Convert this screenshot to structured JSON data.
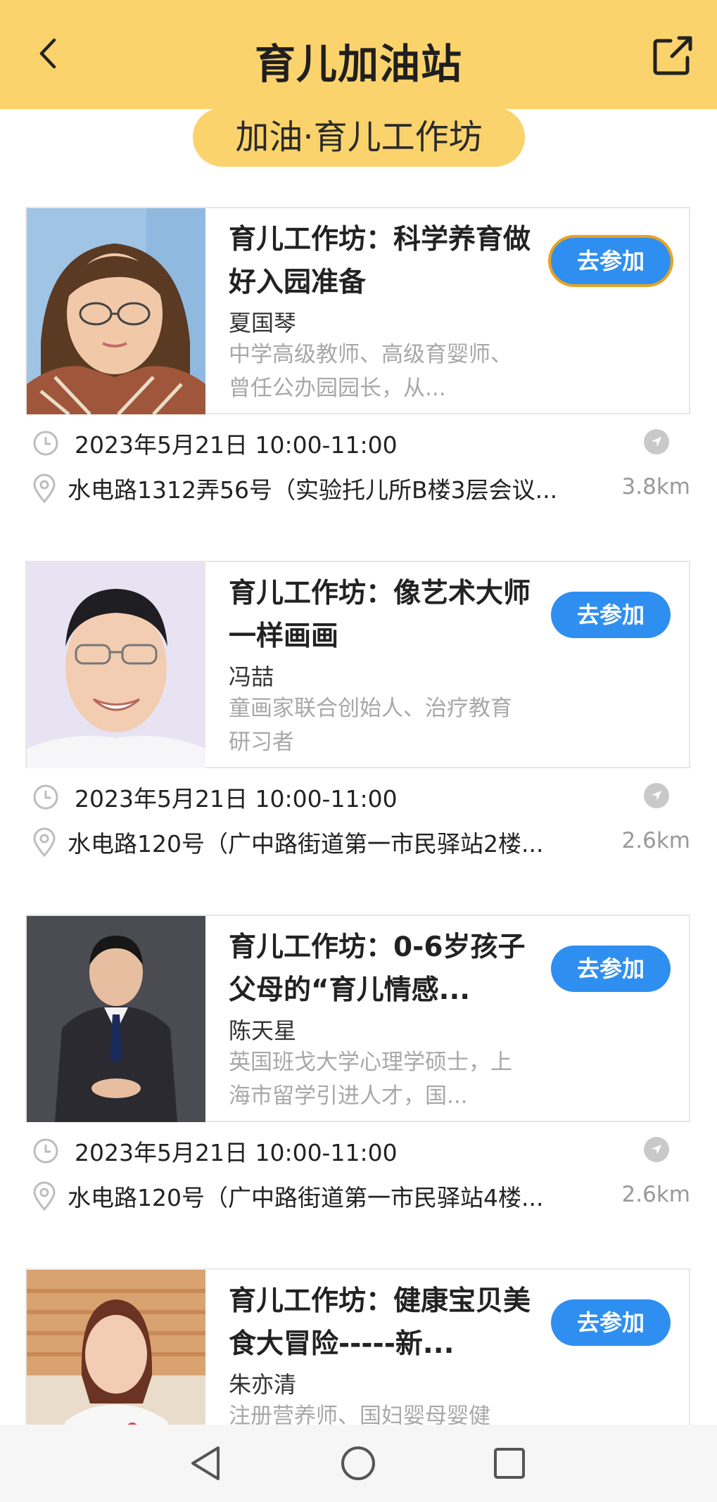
{
  "header": {
    "title": "育儿加油站"
  },
  "section": {
    "title": "加油·育儿工作坊"
  },
  "items": [
    {
      "title": "育儿工作坊：科学养育做好入园准备",
      "speaker": "夏国琴",
      "description": "中学高级教师、高级育婴师、曾任公办园园长，从...",
      "button": "去参加",
      "time": "2023年5月21日 10:00-11:00",
      "location": "水电路1312弄56号（实验托儿所B楼3层会议...",
      "distance": "3.8km"
    },
    {
      "title": "育儿工作坊：像艺术大师一样画画",
      "speaker": "冯喆",
      "description": "童画家联合创始人、治疗教育研习者",
      "button": "去参加",
      "time": "2023年5月21日 10:00-11:00",
      "location": "水电路120号（广中路街道第一市民驿站2楼...",
      "distance": "2.6km"
    },
    {
      "title": "育儿工作坊：0-6岁孩子父母的“育儿情感...",
      "speaker": "陈天星",
      "description": "英国班戈大学心理学硕士，上海市留学引进人才，国...",
      "button": "去参加",
      "time": "2023年5月21日 10:00-11:00",
      "location": "水电路120号（广中路街道第一市民驿站4楼...",
      "distance": "2.6km"
    },
    {
      "title": "育儿工作坊：健康宝贝美食大冒险-----新...",
      "speaker": "朱亦清",
      "description": "注册营养师、国妇婴母婴健",
      "button": "去参加"
    }
  ],
  "colors": {
    "header": "#fbd36c",
    "button": "#2f8ff0",
    "focus": "#e8a322"
  },
  "icons": {
    "back": "chevron-left-icon",
    "share": "share-icon",
    "clock": "clock-icon",
    "pin": "location-pin-icon",
    "nav": "navigation-arrow-icon",
    "sys_back": "triangle-back-icon",
    "sys_home": "circle-home-icon",
    "sys_recent": "square-recent-icon"
  }
}
